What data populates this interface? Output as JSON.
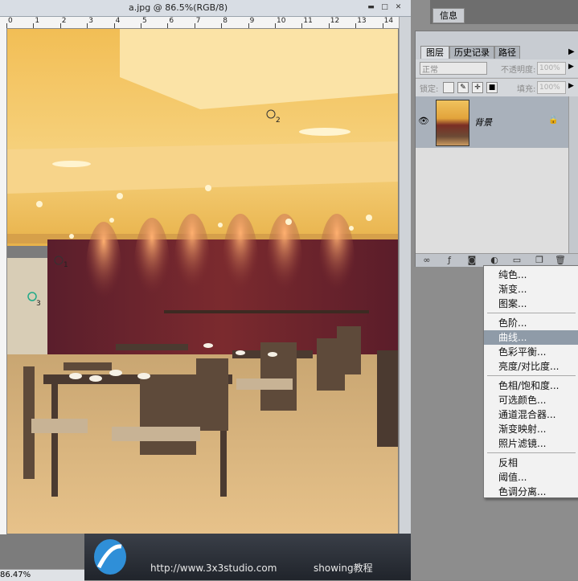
{
  "document": {
    "title": "a.jpg @ 86.5%(RGB/8)",
    "zoom": "86.47%",
    "ruler_ticks": [
      "0",
      "1",
      "2",
      "3",
      "4",
      "5",
      "6",
      "7",
      "8",
      "9",
      "10",
      "11",
      "12",
      "13",
      "14"
    ],
    "markers": [
      "1",
      "2",
      "3"
    ]
  },
  "info_panel": {
    "tab_label": "信息"
  },
  "layers_panel": {
    "tabs": [
      "图层",
      "历史记录",
      "路径"
    ],
    "blend_mode": "正常",
    "opacity_label": "不透明度:",
    "opacity_value": "100%",
    "lock_label": "锁定:",
    "fill_label": "填充:",
    "fill_value": "100%",
    "layer": {
      "name": "背景"
    }
  },
  "adjust_menu": {
    "groups": [
      [
        "纯色...",
        "渐变...",
        "图案..."
      ],
      [
        "色阶...",
        "曲线...",
        "色彩平衡...",
        "亮度/对比度..."
      ],
      [
        "色相/饱和度...",
        "可选颜色...",
        "通道混合器...",
        "渐变映射...",
        "照片滤镜..."
      ],
      [
        "反相",
        "阈值...",
        "色调分离..."
      ]
    ],
    "highlighted": "曲线..."
  },
  "banner": {
    "url": "http://www.3x3studio.com",
    "tagline": "showing教程"
  }
}
